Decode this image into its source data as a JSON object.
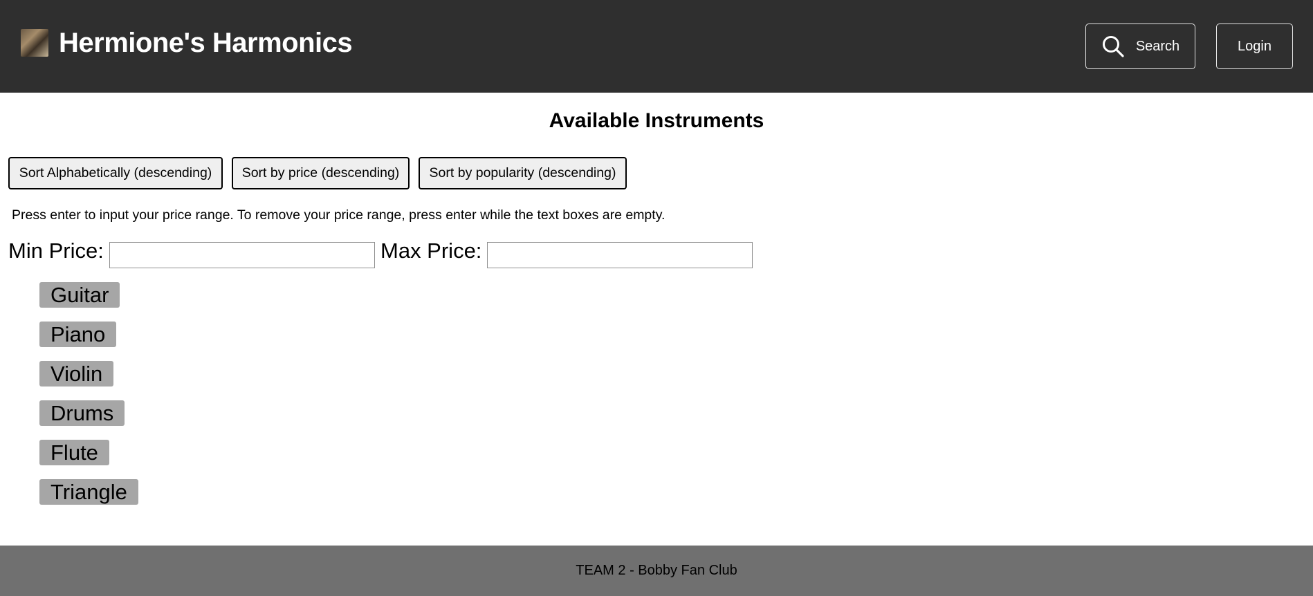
{
  "header": {
    "brand": "Hermione's Harmonics",
    "search_label": "Search",
    "login_label": "Login"
  },
  "main": {
    "title": "Available Instruments",
    "sort_buttons": [
      "Sort Alphabetically (descending)",
      "Sort by price (descending)",
      "Sort by popularity (descending)"
    ],
    "hint": "Press enter to input your price range. To remove your price range, press enter while the text boxes are empty.",
    "min_price_label": "Min Price:",
    "max_price_label": "Max Price:",
    "min_price_value": "",
    "max_price_value": "",
    "instruments": [
      "Guitar",
      "Piano",
      "Violin",
      "Drums",
      "Flute",
      "Triangle"
    ]
  },
  "footer": {
    "text": "TEAM 2 - Bobby Fan Club"
  },
  "colors": {
    "header_bg": "#2f2f2f",
    "footer_bg": "#707070",
    "item_bg": "#a6a6a6",
    "button_bg": "#efefef"
  },
  "icons": {
    "search": "search-icon"
  }
}
